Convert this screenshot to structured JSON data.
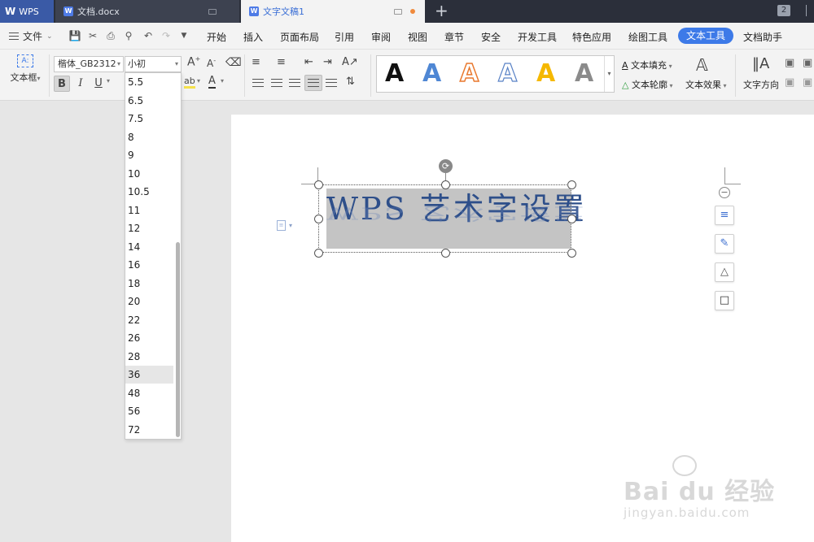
{
  "tabs": {
    "wps": {
      "logo": "W",
      "label": "WPS"
    },
    "doc1": {
      "icon": "W",
      "label": "文档.docx"
    },
    "doc2": {
      "icon": "W",
      "label": "文字文稿1"
    },
    "new_tab": "+",
    "window_count": "2"
  },
  "menu": {
    "file": "文件",
    "items": [
      "开始",
      "插入",
      "页面布局",
      "引用",
      "审阅",
      "视图",
      "章节",
      "安全",
      "开发工具",
      "特色应用",
      "绘图工具",
      "文本工具",
      "文档助手"
    ],
    "active": "文本工具"
  },
  "ribbon": {
    "textbox_label": "文本框",
    "font_name": "楷体_GB2312",
    "font_size": "小初",
    "bold": "B",
    "italic": "I",
    "underline": "U",
    "highlight": "ab",
    "font_color": "A",
    "grow": "A",
    "shrink": "A",
    "style_letters": [
      "A",
      "A",
      "A",
      "A",
      "A",
      "A"
    ],
    "text_fill": "文本填充",
    "text_outline": "文本轮廓",
    "text_effect": "文本效果",
    "text_direction": "文字方向"
  },
  "font_sizes": [
    "5.5",
    "6.5",
    "7.5",
    "8",
    "9",
    "10",
    "10.5",
    "11",
    "12",
    "14",
    "16",
    "18",
    "20",
    "22",
    "26",
    "28",
    "36",
    "48",
    "56",
    "72"
  ],
  "selected_size": "36",
  "document": {
    "art_text": "WPS 艺术字设置"
  },
  "watermark": {
    "brand": "Bai du 经验",
    "url": "jingyan.baidu.com"
  },
  "colors": {
    "accent": "#3d7ae8",
    "art_text": "#2e4f8a",
    "art_bg": "#c4c4c4"
  }
}
